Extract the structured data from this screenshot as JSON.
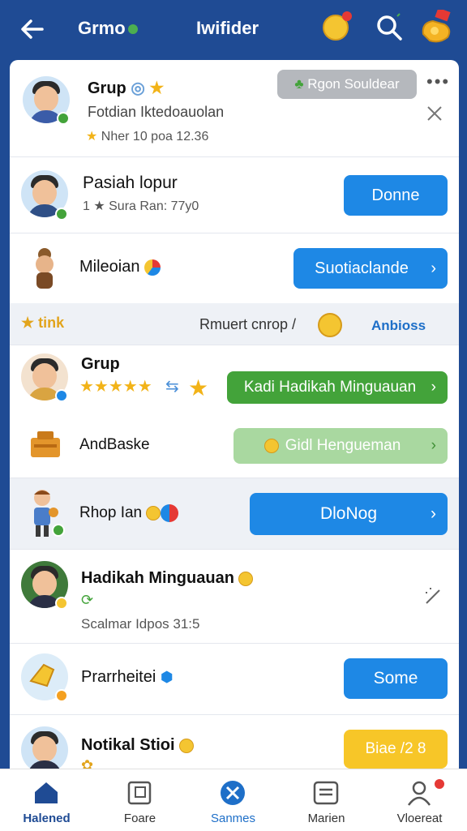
{
  "header": {
    "title_left": "Grmo",
    "title_center": "Iwifider"
  },
  "rows": [
    {
      "name": "Grup",
      "subtitle": "Fotdian Iktedoauolan",
      "meta": "Nher 10 poa 12.36",
      "button": "Rgon  Souldear"
    },
    {
      "name": "Pasiah lopur",
      "meta": "1 ★ Sura Ran: 77y0",
      "button": "Donne"
    },
    {
      "name": "Mileoian",
      "button": "Suotiaclande"
    },
    {
      "section_left": "★ tink",
      "section_mid": "Rmuert cnrop /",
      "section_right": "Anbioss"
    },
    {
      "name": "Grup",
      "stars": "★★★★★",
      "button": "Kadi Hadikah Minguauan"
    },
    {
      "name": "AndBaske",
      "button": "Gidl Hengueman"
    },
    {
      "name": "Rhop Ian",
      "button": "DloNog"
    },
    {
      "name": "Hadikah Minguauan",
      "meta": "Scalmar Idpos  31:5"
    },
    {
      "name": "Prarrheitei",
      "button": "Some"
    },
    {
      "name": "Notikal Stioi",
      "button": "Biae  /2  8"
    }
  ],
  "nav": [
    {
      "label": "Halened",
      "icon": "home-icon"
    },
    {
      "label": "Foare",
      "icon": "frame-icon"
    },
    {
      "label": "Sanmes",
      "icon": "compass-icon"
    },
    {
      "label": "Marien",
      "icon": "list-icon"
    },
    {
      "label": "Vloereat",
      "icon": "profile-icon"
    }
  ],
  "colors": {
    "primary": "#1f4b94",
    "button_blue": "#1e88e5",
    "button_green": "#43a33a",
    "button_yellow": "#f7c628"
  }
}
